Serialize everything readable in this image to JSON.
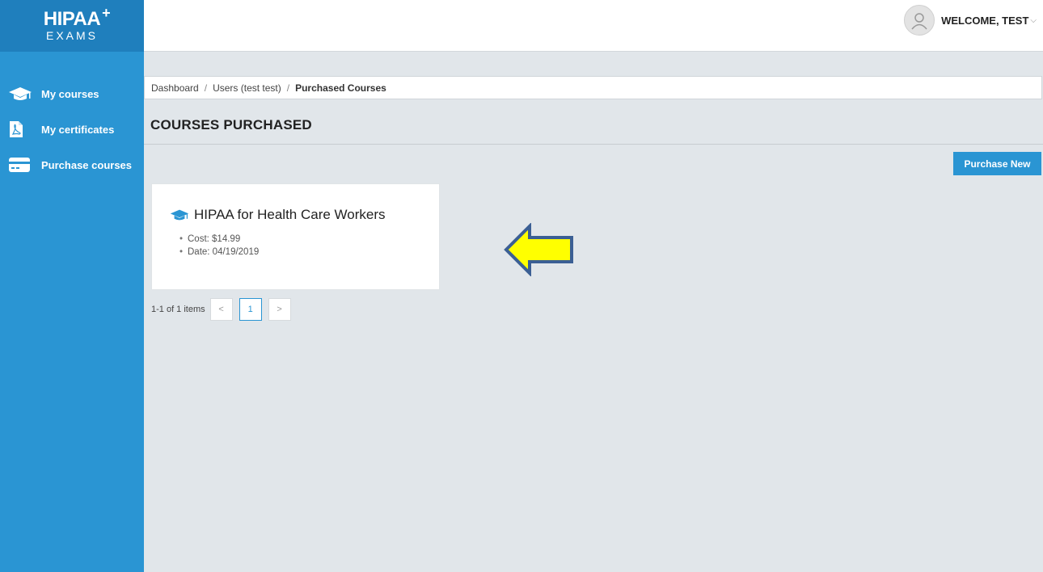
{
  "brand": {
    "logo_top": "HIPAA",
    "logo_plus": "+",
    "logo_bottom": "EXAMS"
  },
  "sidebar": {
    "items": [
      {
        "label": "My courses",
        "icon": "graduation-cap-icon"
      },
      {
        "label": "My certificates",
        "icon": "pdf-file-icon"
      },
      {
        "label": "Purchase courses",
        "icon": "credit-card-icon"
      }
    ]
  },
  "header": {
    "welcome": "WELCOME, TEST",
    "caret": "⌵"
  },
  "breadcrumb": {
    "dashboard": "Dashboard",
    "sep": "/",
    "users": "Users (test test)",
    "current": "Purchased Courses"
  },
  "page": {
    "title": "COURSES PURCHASED",
    "purchase_new": "Purchase New"
  },
  "course": {
    "title": "HIPAA for Health Care Workers",
    "cost": "Cost: $14.99",
    "date": "Date: 04/19/2019"
  },
  "pagination": {
    "info": "1-1 of 1 items",
    "prev": "<",
    "current": "1",
    "next": ">"
  },
  "colors": {
    "sidebar": "#2a95d3",
    "logo_bg": "#1f7fbd",
    "accent": "#2a95d3",
    "background": "#e1e6ea",
    "arrow_fill": "#ffff00",
    "arrow_stroke": "#3b5f94"
  }
}
